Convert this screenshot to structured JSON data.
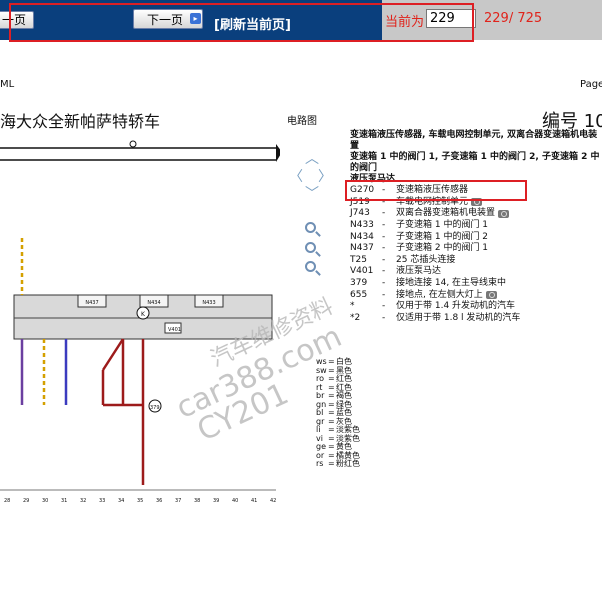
{
  "toolbar": {
    "prev_label": "一页",
    "next_label": "下一页",
    "next_arrow": "▸",
    "refresh_label": "[刷新当前页]",
    "current_label": "当前为",
    "page_value": "229",
    "page_total": "229/ 725",
    "colors": {
      "bar": "#0a3f7d",
      "highlight": "#dd1f24",
      "status_text": "#e0231b"
    }
  },
  "header": {
    "left_fragment": "ML",
    "right_fragment": "Page",
    "doc_title": "海大众全新帕萨特轿车",
    "circuit_label": "电路图",
    "code_label": "编号 10"
  },
  "legend": {
    "heading": [
      "变速箱液压传感器, 车载电网控制单元, 双离合器变速箱机电装置",
      "变速箱 1 中的阀门 1, 子变速箱 1 中的阀门 2, 子变速箱 2 中的阀门",
      "液压泵马达"
    ],
    "items": [
      {
        "code": "G270",
        "dash": "-",
        "text": "变速箱液压传感器",
        "camera": false
      },
      {
        "code": "J519",
        "dash": "-",
        "text": "车载电网控制单元",
        "camera": true
      },
      {
        "code": "J743",
        "dash": "-",
        "text": "双离合器变速箱机电装置",
        "camera": true
      },
      {
        "code": "N433",
        "dash": "-",
        "text": "子变速箱 1 中的阀门 1",
        "camera": false
      },
      {
        "code": "N434",
        "dash": "-",
        "text": "子变速箱 1 中的阀门 2",
        "camera": false
      },
      {
        "code": "N437",
        "dash": "-",
        "text": "子变速箱 2 中的阀门 1",
        "camera": false
      },
      {
        "code": "T25",
        "dash": "-",
        "text": "25 芯插头连接",
        "camera": false
      },
      {
        "code": "V401",
        "dash": "-",
        "text": "液压泵马达",
        "camera": false
      },
      {
        "code": "379",
        "dash": "-",
        "text": "接地连接 14, 在主导线束中",
        "camera": false
      },
      {
        "code": "655",
        "dash": "-",
        "text": "接地点, 在左侧大灯上",
        "camera": true
      },
      {
        "code": "*",
        "dash": "-",
        "text": "仅用于带 1.4 升发动机的汽车",
        "camera": false
      },
      {
        "code": "*2",
        "dash": "-",
        "text": "仅适用于带 1.8 l 发动机的汽车",
        "camera": false
      }
    ]
  },
  "wire_colors": [
    {
      "code": "ws",
      "name": "白色"
    },
    {
      "code": "sw",
      "name": "黑色"
    },
    {
      "code": "ro",
      "name": "红色"
    },
    {
      "code": "rt",
      "name": "红色"
    },
    {
      "code": "br",
      "name": "褐色"
    },
    {
      "code": "gn",
      "name": "绿色"
    },
    {
      "code": "bl",
      "name": "蓝色"
    },
    {
      "code": "gr",
      "name": "灰色"
    },
    {
      "code": "li",
      "name": "淡紫色"
    },
    {
      "code": "vi",
      "name": "淡紫色"
    },
    {
      "code": "ge",
      "name": "黄色"
    },
    {
      "code": "or",
      "name": "橘黄色"
    },
    {
      "code": "rs",
      "name": "粉红色"
    }
  ],
  "diagram": {
    "connector_ids": [
      "N437",
      "N434",
      "N433"
    ],
    "bus_number": "K",
    "motor_label": "V401",
    "ground_label": "379",
    "column_numbers": [
      "28",
      "29",
      "30",
      "31",
      "32",
      "33",
      "34",
      "35",
      "36",
      "37",
      "38",
      "39",
      "40",
      "41",
      "42"
    ]
  },
  "watermark": {
    "line1": "汽车维修资料",
    "line2": "car388.com",
    "line3": "CY201"
  }
}
